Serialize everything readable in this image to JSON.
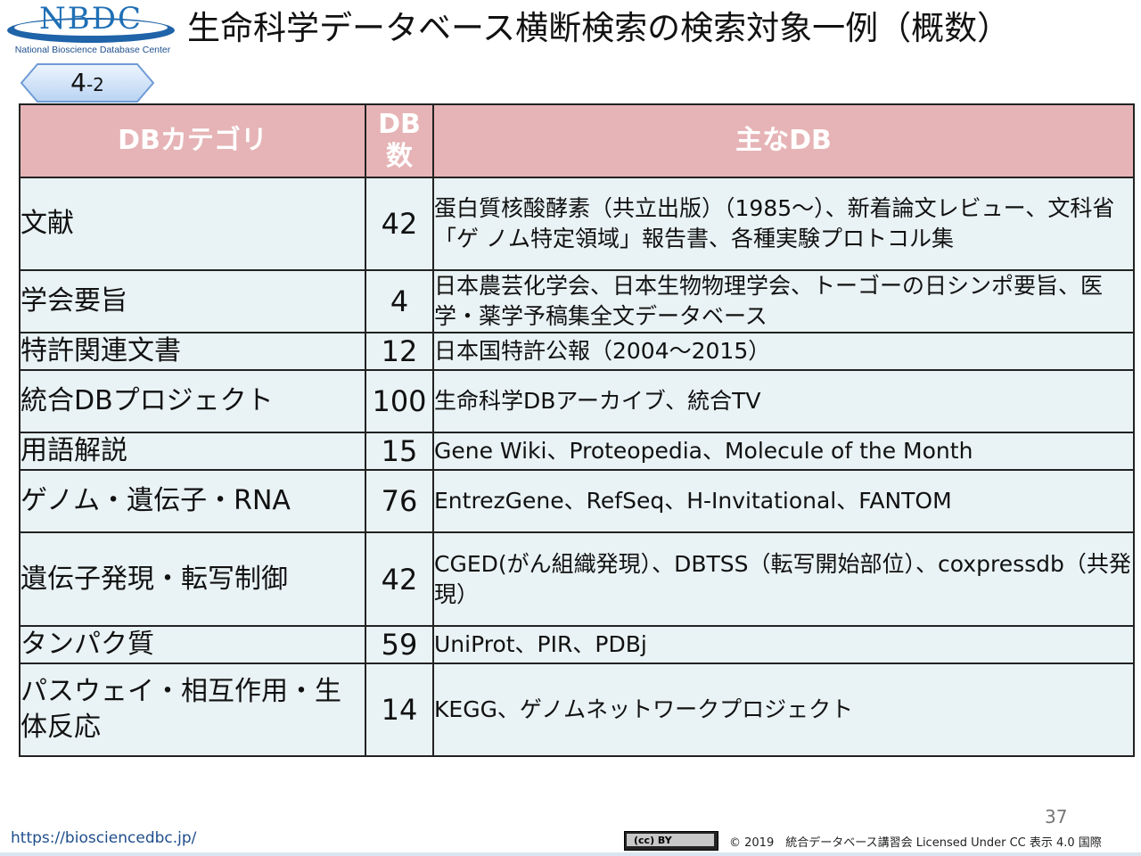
{
  "header": {
    "logo_text": "NBDC",
    "logo_subtitle": "National Bioscience Database Center",
    "title": "生命科学データベース横断検索の検索対象一例（概数）",
    "badge_main": "4",
    "badge_sub": "-2"
  },
  "table": {
    "headers": {
      "category": "DBカテゴリ",
      "count_line1": "DB",
      "count_line2": "数",
      "main": "主なDB"
    },
    "rows": [
      {
        "category": "文献",
        "count": "42",
        "main": "蛋白質核酸酵素（共立出版）（1985～）、新着論文レビュー、文科省「ゲ ノム特定領域」報告書、各種実験プロトコル集"
      },
      {
        "category": "学会要旨",
        "count": "4",
        "main": "日本農芸化学会、日本生物物理学会、トーゴーの日シンポ要旨、医学・薬学予稿集全文データベース"
      },
      {
        "category": "特許関連文書",
        "count": "12",
        "main": "日本国特許公報（2004～2015）"
      },
      {
        "category": "統合DBプロジェクト",
        "count": "100",
        "main": "生命科学DBアーカイブ、統合TV"
      },
      {
        "category": "用語解説",
        "count": "15",
        "main": "Gene Wiki、Proteopedia、Molecule of the Month"
      },
      {
        "category": "ゲノム・遺伝子・RNA",
        "count": "76",
        "main": "EntrezGene、RefSeq、H-Invitational、FANTOM"
      },
      {
        "category": "遺伝子発現・転写制御",
        "count": "42",
        "main": "CGED(がん組織発現）、DBTSS（転写開始部位）、coxpressdb（共発現）"
      },
      {
        "category": "タンパク質",
        "count": "59",
        "main": "UniProt、PIR、PDBj"
      },
      {
        "category": "パスウェイ・相互作用・生体反応",
        "count": "14",
        "main": "KEGG、ゲノムネットワークプロジェクト"
      }
    ]
  },
  "footer": {
    "page_number": "37",
    "url": "https://biosciencedbc.jp/",
    "cc_badge": "(cc) BY",
    "copyright": "© 2019　統合データベース講習会 Licensed Under CC 表示 4.0 国際"
  }
}
